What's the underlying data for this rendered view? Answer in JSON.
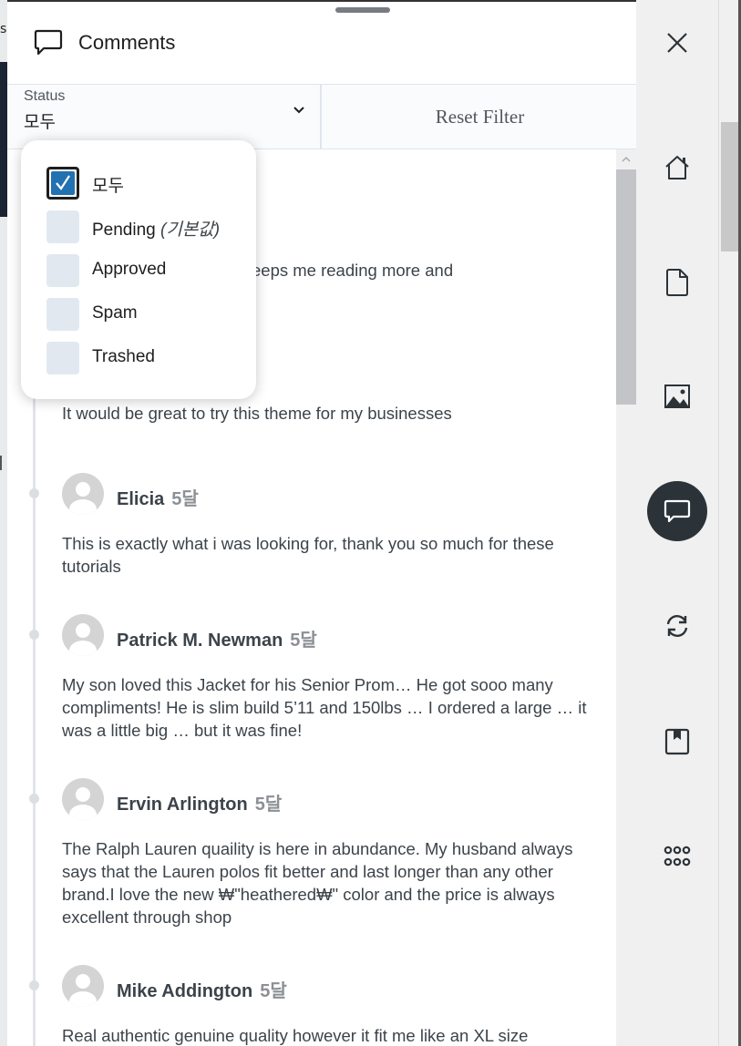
{
  "header": {
    "title": "Comments",
    "icon": "comment-icon"
  },
  "filter": {
    "status_label": "Status",
    "status_value": "모두",
    "reset_label": "Reset Filter"
  },
  "dropdown": {
    "options": [
      {
        "label": "모두",
        "note": "",
        "checked": true
      },
      {
        "label": "Pending",
        "note": "(기본값)",
        "checked": false
      },
      {
        "label": "Approved",
        "note": "",
        "checked": false
      },
      {
        "label": "Spam",
        "note": "",
        "checked": false
      },
      {
        "label": "Trashed",
        "note": "",
        "checked": false
      }
    ]
  },
  "partial_comment_text": "eeps me reading more and",
  "comments": [
    {
      "author": "",
      "time": "",
      "text": "It would be great to try this theme for my businesses"
    },
    {
      "author": "Elicia",
      "time": "5달",
      "text": "This is exactly what i was looking for, thank you so much for these tutorials"
    },
    {
      "author": "Patrick M. Newman",
      "time": "5달",
      "text": "My son loved this Jacket for his Senior Prom… He got sooo many compliments! He is slim build 5’11 and 150lbs … I ordered a large … it was a little big … but it was fine!"
    },
    {
      "author": "Ervin Arlington",
      "time": "5달",
      "text": "The Ralph Lauren quaility is here in abundance. My husband always says that the Lauren polos fit better and last longer than any other brand.I love the new ₩\"heathered₩\" color and the price is always excellent through shop"
    },
    {
      "author": "Mike Addington",
      "time": "5달",
      "text": "Real authentic genuine quality however it fit me like an XL size"
    }
  ],
  "dock": {
    "items": [
      "home-icon",
      "page-icon",
      "image-icon",
      "comment-icon",
      "sync-icon",
      "bookmark-icon",
      "apps-icon"
    ],
    "active": "comment-icon",
    "close_icon": "close-icon"
  },
  "colors": {
    "accent": "#2271b1",
    "dock_active": "#2c3338",
    "dock_bg": "#f0f0f1"
  }
}
